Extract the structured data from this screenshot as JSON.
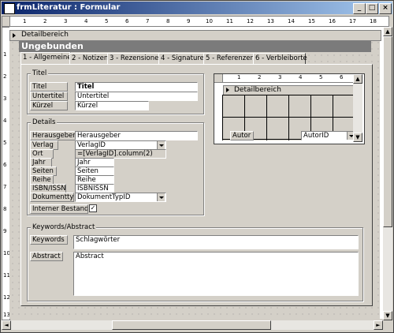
{
  "window": {
    "title": "frmLiteratur : Formular"
  },
  "titlebar_buttons": [
    "_",
    "□",
    "×"
  ],
  "section": {
    "label": "Detailbereich"
  },
  "header": {
    "title": "Ungebunden"
  },
  "tabs": [
    "1 - Allgemeines",
    "2 - Notizen",
    "3 - Rezensionen",
    "4 - Signaturen",
    "5 - Referenzen",
    "6 - Verbleiborte"
  ],
  "ruler": {
    "h_ticks": [
      "1",
      "2",
      "3",
      "4",
      "5",
      "6",
      "7",
      "8",
      "9",
      "10",
      "11",
      "12",
      "13",
      "14",
      "15",
      "16",
      "17",
      "18"
    ],
    "v_ticks": [
      "1",
      "2",
      "3",
      "4",
      "5",
      "6",
      "7",
      "8",
      "9",
      "10",
      "11",
      "12",
      "13"
    ]
  },
  "titel_group": {
    "label": "Titel",
    "fields": [
      {
        "label": "Titel",
        "value": "Titel"
      },
      {
        "label": "Untertitel",
        "value": "Untertitel"
      },
      {
        "label": "Kürzel",
        "value": "Kürzel"
      }
    ]
  },
  "details_group": {
    "label": "Details",
    "fields": [
      {
        "label": "Herausgeber/Ki",
        "value": "Herausgeber"
      },
      {
        "label": "Verlag",
        "value": "VerlagID"
      },
      {
        "label": "Ort",
        "value": "=[VerlagID].column(2)"
      },
      {
        "label": "Jahr",
        "value": "Jahr"
      },
      {
        "label": "Seiten",
        "value": "Seiten"
      },
      {
        "label": "Reihe",
        "value": "Reihe"
      },
      {
        "label": "ISBN/ISSN",
        "value": "ISBNISSN"
      },
      {
        "label": "Dokumenttyp",
        "value": "DokumentTypID"
      }
    ],
    "checkbox": {
      "label": "Interner Bestand?",
      "checked": "✓"
    }
  },
  "keywords_group": {
    "label": "Keywords/Abstract",
    "keywords_label": "Keywords",
    "keywords_value": "Schlagwörter",
    "abstract_label": "Abstract",
    "abstract_value": "Abstract"
  },
  "subform": {
    "section_label": "Detailbereich",
    "field_label": "Autor",
    "field_value": "AutorID",
    "ruler_ticks": [
      "1",
      "2",
      "3",
      "4",
      "5",
      "6"
    ]
  }
}
